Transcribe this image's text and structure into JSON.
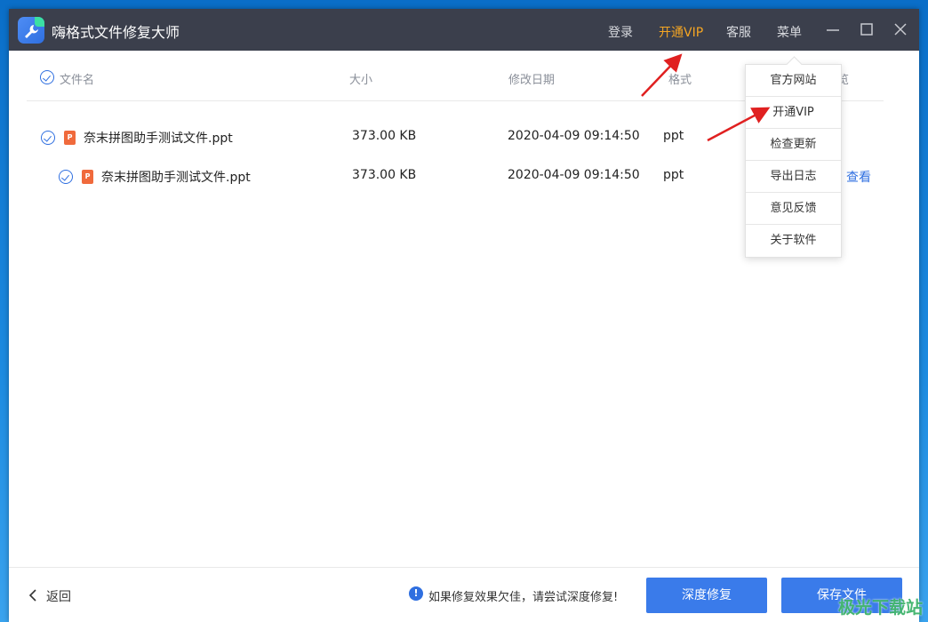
{
  "app": {
    "title": "嗨格式文件修复大师"
  },
  "titlebar": {
    "login_label": "登录",
    "vip_label": "开通VIP",
    "service_label": "客服",
    "menu_label": "菜单"
  },
  "table": {
    "headers": {
      "name": "文件名",
      "size": "大小",
      "date": "修改日期",
      "format": "格式",
      "preview": "览"
    },
    "rows": [
      {
        "name": "奈末拼图助手测试文件.ppt",
        "size": "373.00 KB",
        "date": "2020-04-09 09:14:50",
        "format": "ppt",
        "preview": ""
      },
      {
        "name": "奈末拼图助手测试文件.ppt",
        "size": "373.00 KB",
        "date": "2020-04-09 09:14:50",
        "format": "ppt",
        "preview": "查看"
      }
    ],
    "file_icon_letter": "P"
  },
  "menu": {
    "items": [
      "官方网站",
      "开通VIP",
      "检查更新",
      "导出日志",
      "意见反馈",
      "关于软件"
    ]
  },
  "footer": {
    "back_label": "返回",
    "tip_icon": "!",
    "tip_text": "如果修复效果欠佳，请尝试深度修复!",
    "deep_repair_label": "深度修复",
    "save_label": "保存文件"
  },
  "watermark": "极光下载站",
  "colors": {
    "titlebar": "#3b3f4c",
    "accent": "#3a7bea",
    "vip": "#f5a623",
    "annotation_arrow": "#e02020"
  }
}
